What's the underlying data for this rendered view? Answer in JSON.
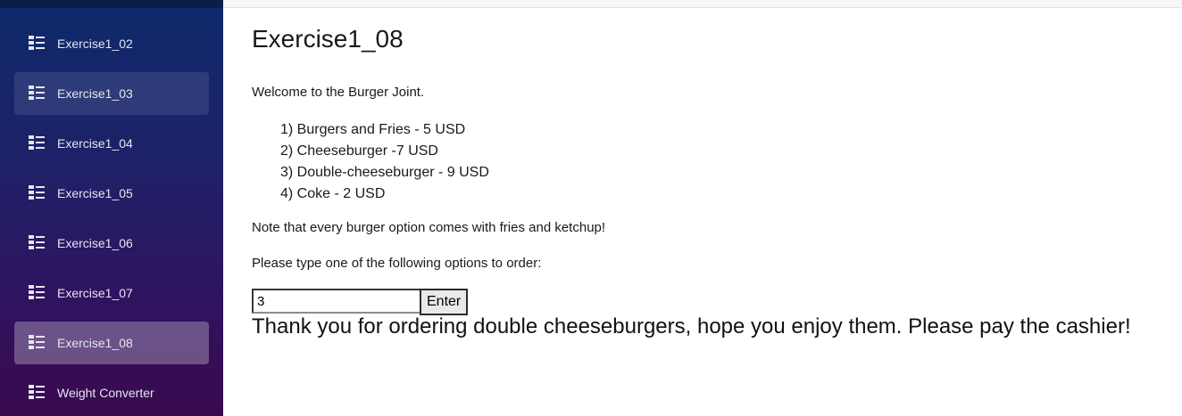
{
  "sidebar": {
    "items": [
      {
        "label": "Exercise1_02",
        "icon": "list-icon",
        "state": "normal"
      },
      {
        "label": "Exercise1_03",
        "icon": "list-icon",
        "state": "hover"
      },
      {
        "label": "Exercise1_04",
        "icon": "list-icon",
        "state": "normal"
      },
      {
        "label": "Exercise1_05",
        "icon": "list-icon",
        "state": "normal"
      },
      {
        "label": "Exercise1_06",
        "icon": "list-icon",
        "state": "normal"
      },
      {
        "label": "Exercise1_07",
        "icon": "list-icon",
        "state": "normal"
      },
      {
        "label": "Exercise1_08",
        "icon": "list-icon",
        "state": "active"
      },
      {
        "label": "Weight Converter",
        "icon": "list-icon",
        "state": "normal"
      }
    ]
  },
  "main": {
    "title": "Exercise1_08",
    "welcome": "Welcome to the Burger Joint.",
    "menu": [
      "1) Burgers and Fries - 5 USD",
      "2) Cheeseburger -7 USD",
      "3) Double-cheeseburger - 9 USD",
      "4) Coke - 2 USD"
    ],
    "note": "Note that every burger option comes with fries and ketchup!",
    "prompt": "Please type one of the following options to order:",
    "input_value": "3",
    "enter_label": "Enter",
    "result": "Thank you for ordering double cheeseburgers, hope you enjoy them. Please pay the cashier!"
  },
  "colors": {
    "sidebar_top": "#0d2a6b",
    "sidebar_bottom": "#3a0a4f",
    "nav_text": "#e6e6f0"
  }
}
